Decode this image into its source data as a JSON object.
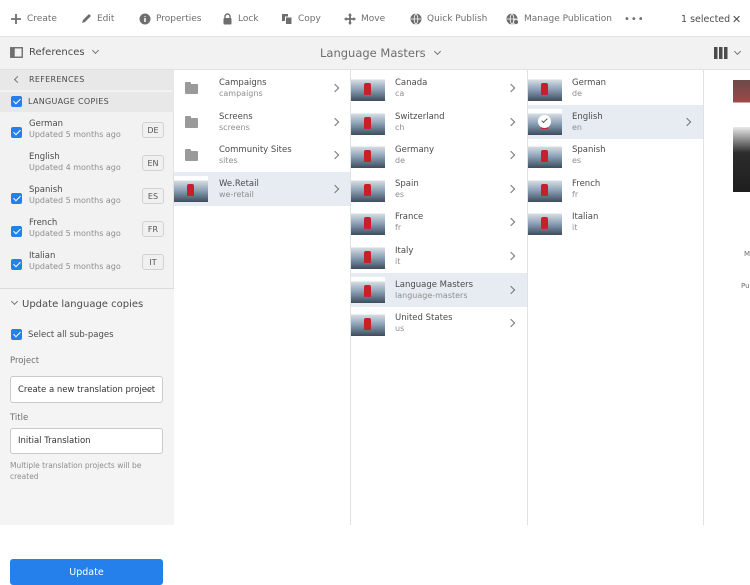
{
  "toolbar": {
    "create": "Create",
    "edit": "Edit",
    "properties": "Properties",
    "lock": "Lock",
    "copy": "Copy",
    "move": "Move",
    "quick_publish": "Quick Publish",
    "manage_publication": "Manage Publication",
    "more": "•••",
    "selected": "1 selected",
    "close": "✕"
  },
  "rail_switcher": {
    "label": "References"
  },
  "breadcrumb": {
    "title": "Language Masters"
  },
  "references_panel": {
    "header": "REFERENCES",
    "language_copies_label": "LANGUAGE COPIES",
    "languages": [
      {
        "name": "German",
        "updated": "Updated 5 months ago",
        "code": "DE",
        "checked": true
      },
      {
        "name": "English",
        "updated": "Updated 4 months ago",
        "code": "EN",
        "checked": false
      },
      {
        "name": "Spanish",
        "updated": "Updated 5 months ago",
        "code": "ES",
        "checked": true
      },
      {
        "name": "French",
        "updated": "Updated 5 months ago",
        "code": "FR",
        "checked": true
      },
      {
        "name": "Italian",
        "updated": "Updated 5 months ago",
        "code": "IT",
        "checked": true
      }
    ],
    "update_section_title": "Update language copies",
    "select_all_label": "Select all sub-pages",
    "project_label": "Project",
    "project_value": "Create a new translation project",
    "title_label": "Title",
    "title_value": "Initial Translation",
    "help_text": "Multiple translation projects will be created",
    "update_button": "Update"
  },
  "columns": {
    "col1": [
      {
        "title": "Campaigns",
        "sub": "campaigns",
        "icon": "folder-icon"
      },
      {
        "title": "Screens",
        "sub": "screens",
        "icon": "folder-icon"
      },
      {
        "title": "Community Sites",
        "sub": "sites",
        "icon": "folder-icon"
      },
      {
        "title": "We.Retail",
        "sub": "we-retail",
        "icon": "page-thumbnail",
        "selected": true
      }
    ],
    "col2": [
      {
        "title": "Canada",
        "sub": "ca"
      },
      {
        "title": "Switzerland",
        "sub": "ch"
      },
      {
        "title": "Germany",
        "sub": "de"
      },
      {
        "title": "Spain",
        "sub": "es"
      },
      {
        "title": "France",
        "sub": "fr"
      },
      {
        "title": "Italy",
        "sub": "it"
      },
      {
        "title": "Language Masters",
        "sub": "language-masters",
        "selected": true
      },
      {
        "title": "United States",
        "sub": "us"
      }
    ],
    "col3": [
      {
        "title": "German",
        "sub": "de"
      },
      {
        "title": "English",
        "sub": "en",
        "selected": true
      },
      {
        "title": "Spanish",
        "sub": "es"
      },
      {
        "title": "French",
        "sub": "fr"
      },
      {
        "title": "Italian",
        "sub": "it"
      }
    ]
  },
  "preview_fragments": {
    "a": "M",
    "b": "Pu"
  },
  "colors": {
    "accent": "#2680eb",
    "selected_row": "#e7ecf3",
    "rail_bg": "#f2f2f2"
  }
}
